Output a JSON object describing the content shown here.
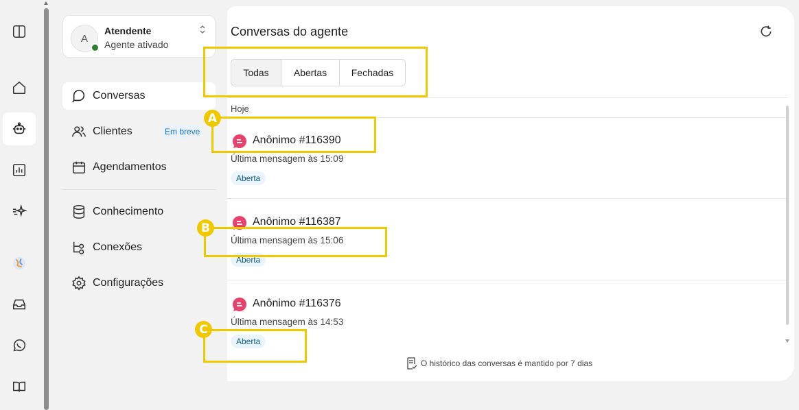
{
  "rail": {
    "items": [
      {
        "icon": "panel-toggle-icon",
        "active": false
      },
      {
        "icon": "home-icon",
        "active": false
      },
      {
        "icon": "robot-icon",
        "active": true
      },
      {
        "icon": "bar-chart-icon",
        "active": false
      },
      {
        "icon": "sparkle-icon",
        "active": false
      },
      {
        "icon": "globe-avatar-icon",
        "active": false
      },
      {
        "icon": "inbox-icon",
        "active": false
      },
      {
        "icon": "whatsapp-icon",
        "active": false
      },
      {
        "icon": "book-icon",
        "active": false
      }
    ]
  },
  "agent": {
    "initial": "A",
    "name": "Atendente",
    "status": "Agente ativado",
    "status_color": "#2e7d32"
  },
  "sidebar": {
    "items": [
      {
        "label": "Conversas",
        "icon": "chat-icon",
        "active": true
      },
      {
        "label": "Clientes",
        "icon": "users-icon",
        "badge": "Em breve"
      },
      {
        "label": "Agendamentos",
        "icon": "calendar-icon"
      },
      {
        "label": "Conhecimento",
        "icon": "database-icon"
      },
      {
        "label": "Conexões",
        "icon": "connections-icon"
      },
      {
        "label": "Configurações",
        "icon": "gear-icon"
      }
    ]
  },
  "main": {
    "title": "Conversas do agente",
    "tabs": [
      {
        "label": "Todas",
        "selected": true
      },
      {
        "label": "Abertas",
        "selected": false
      },
      {
        "label": "Fechadas",
        "selected": false
      }
    ],
    "group_label": "Hoje",
    "conversations": [
      {
        "name": "Anônimo #116390",
        "last_message": "Última mensagem às 15:09",
        "status": "Aberta"
      },
      {
        "name": "Anônimo #116387",
        "last_message": "Última mensagem às 15:06",
        "status": "Aberta"
      },
      {
        "name": "Anônimo #116376",
        "last_message": "Última mensagem às 14:53",
        "status": "Aberta"
      }
    ],
    "footer_note": "O histórico das conversas é mantido por 7 dias"
  },
  "annotations": {
    "markers": [
      "A",
      "B",
      "C"
    ],
    "color": "#f0c800"
  }
}
